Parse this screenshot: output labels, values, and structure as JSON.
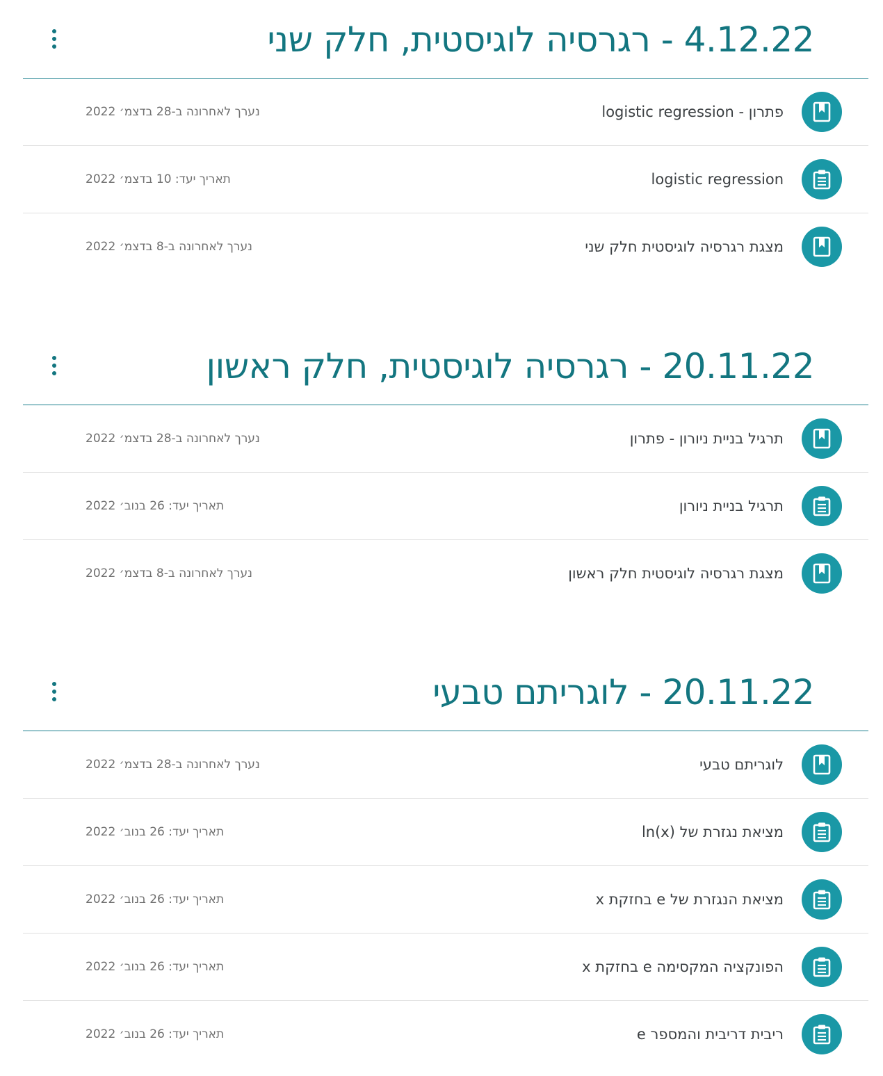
{
  "colors": {
    "accent": "#137680",
    "icon_bg": "#1a98a6",
    "meta_text": "#6f6f6f",
    "divider": "#e0e0e0"
  },
  "topics": [
    {
      "title": "4.12.22 - רגרסיה לוגיסטית, חלק שני",
      "items": [
        {
          "type": "material",
          "icon": "book-icon",
          "title": "פתרון - logistic regression",
          "meta": "נערך לאחרונה ב-28 בדצמ׳ 2022"
        },
        {
          "type": "assignment",
          "icon": "clipboard-icon",
          "title": "logistic regression",
          "meta": "תאריך יעד: 10 בדצמ׳ 2022"
        },
        {
          "type": "material",
          "icon": "book-icon",
          "title": "מצגת רגרסיה לוגיסטית חלק שני",
          "meta": "נערך לאחרונה ב-8 בדצמ׳ 2022"
        }
      ]
    },
    {
      "title": "20.11.22 - רגרסיה לוגיסטית, חלק ראשון",
      "items": [
        {
          "type": "material",
          "icon": "book-icon",
          "title": "תרגיל בניית ניורון - פתרון",
          "meta": "נערך לאחרונה ב-28 בדצמ׳ 2022"
        },
        {
          "type": "assignment",
          "icon": "clipboard-icon",
          "title": "תרגיל בניית ניורון",
          "meta": "תאריך יעד: 26 בנוב׳ 2022"
        },
        {
          "type": "material",
          "icon": "book-icon",
          "title": "מצגת רגרסיה לוגיסטית חלק ראשון",
          "meta": "נערך לאחרונה ב-8 בדצמ׳ 2022"
        }
      ]
    },
    {
      "title": "20.11.22 - לוגריתם טבעי",
      "items": [
        {
          "type": "material",
          "icon": "book-icon",
          "title": "לוגריתם טבעי",
          "meta": "נערך לאחרונה ב-28 בדצמ׳ 2022"
        },
        {
          "type": "assignment",
          "icon": "clipboard-icon",
          "title": "מציאת נגזרת של ln(x)",
          "meta": "תאריך יעד: 26 בנוב׳ 2022"
        },
        {
          "type": "assignment",
          "icon": "clipboard-icon",
          "title": "מציאת הנגזרת של e בחזקת x",
          "meta": "תאריך יעד: 26 בנוב׳ 2022"
        },
        {
          "type": "assignment",
          "icon": "clipboard-icon",
          "title": "הפונקציה המקסימה e בחזקת x",
          "meta": "תאריך יעד: 26 בנוב׳ 2022"
        },
        {
          "type": "assignment",
          "icon": "clipboard-icon",
          "title": "ריבית דריבית והמספר e",
          "meta": "תאריך יעד: 26 בנוב׳ 2022"
        }
      ]
    }
  ]
}
